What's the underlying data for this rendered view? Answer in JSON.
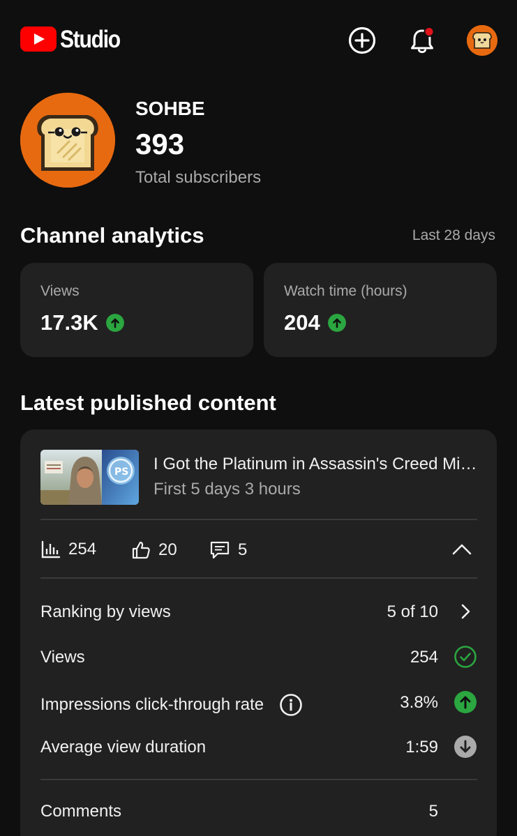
{
  "header": {
    "logo_text": "Studio",
    "icons": [
      "add-circle-icon",
      "bell-icon",
      "avatar"
    ],
    "colors": {
      "brand_red": "#ff0000",
      "notification_dot": "#e0131a"
    }
  },
  "channel": {
    "name": "SOHBE",
    "subscribers": "393",
    "subscribers_label": "Total subscribers"
  },
  "analytics": {
    "title": "Channel analytics",
    "range": "Last 28 days",
    "metrics": [
      {
        "label": "Views",
        "value": "17.3K",
        "trend": "up"
      },
      {
        "label": "Watch time (hours)",
        "value": "204",
        "trend": "up"
      }
    ],
    "colors": {
      "up": "#2ba640"
    }
  },
  "latest": {
    "title": "Latest published content",
    "video": {
      "title": "I Got the Platinum in Assassin's Creed Mirage",
      "subtitle": "First 5 days 3 hours",
      "stats": {
        "views": "254",
        "likes": "20",
        "comments": "5"
      }
    },
    "rows": [
      {
        "label": "Ranking by views",
        "value": "5 of 10",
        "icon": "chevron-right-icon"
      },
      {
        "label": "Views",
        "value": "254",
        "icon": "check-circle-icon"
      },
      {
        "label": "Impressions click-through rate",
        "value": "3.8%",
        "icon": "arrow-up-circle-icon"
      },
      {
        "label": "Average view duration",
        "value": "1:59",
        "icon": "arrow-down-circle-icon"
      },
      {
        "label": "Comments",
        "value": "5"
      }
    ]
  }
}
